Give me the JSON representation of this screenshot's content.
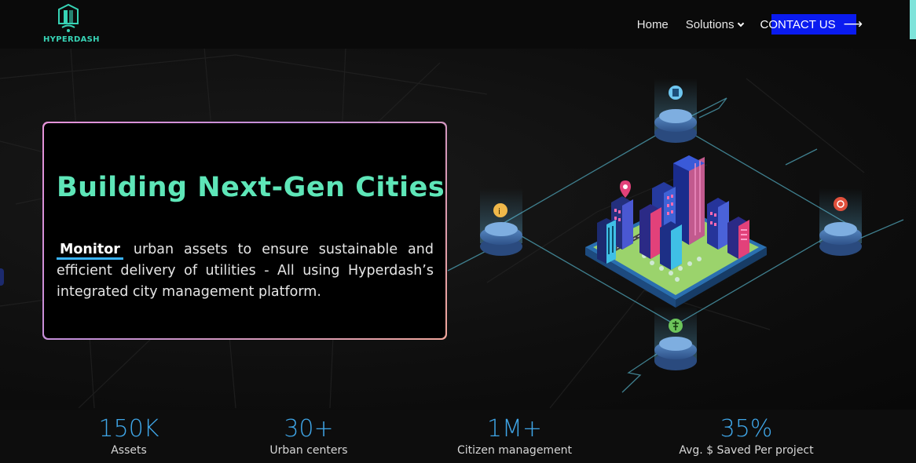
{
  "brand": {
    "name": "HYPERDASH",
    "color": "#37d3b5"
  },
  "nav": {
    "home": "Home",
    "solutions": "Solutions",
    "contact": "CONTACT US",
    "contact_color": "#0a1bf0"
  },
  "hero": {
    "title": "Building Next-Gen Cities",
    "highlight": "Monitor",
    "description": "urban assets to ensure sustainable and efficient delivery of utilities - All using Hyperdash’s integrated city management platform.",
    "title_color": "#5ee6b8"
  },
  "icons": [
    "building-icon",
    "location-pin-icon",
    "info-icon",
    "document-icon",
    "target-icon",
    "utility-pole-icon"
  ],
  "stats": [
    {
      "value": "150K",
      "label": "Assets"
    },
    {
      "value": "30+",
      "label": "Urban centers"
    },
    {
      "value": "1M+",
      "label": "Citizen management"
    },
    {
      "value": "35%",
      "label": "Avg. $ Saved Per project"
    }
  ],
  "stat_color": "#3fa6e8"
}
